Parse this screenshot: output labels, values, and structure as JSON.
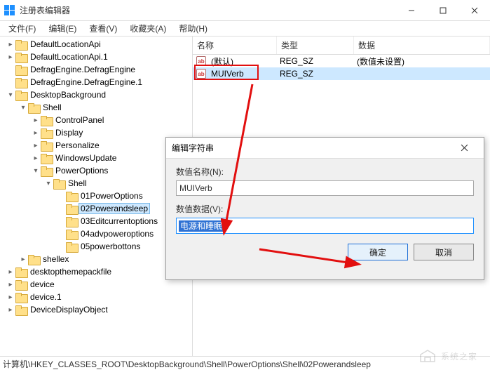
{
  "window": {
    "title": "注册表编辑器",
    "min": "–",
    "max": "□",
    "close": "×"
  },
  "menu": {
    "file": "文件(F)",
    "edit": "编辑(E)",
    "view": "查看(V)",
    "fav": "收藏夹(A)",
    "help": "帮助(H)"
  },
  "list": {
    "headers": {
      "name": "名称",
      "type": "类型",
      "data": "数据"
    },
    "rows": [
      {
        "name": "(默认)",
        "type": "REG_SZ",
        "data": "(数值未设置)",
        "selected": false
      },
      {
        "name": "MUIVerb",
        "type": "REG_SZ",
        "data": "",
        "selected": true
      }
    ],
    "value_icon_text": "ab"
  },
  "tree": [
    {
      "depth": 0,
      "exp": ">",
      "label": "DefaultLocationApi"
    },
    {
      "depth": 0,
      "exp": ">",
      "label": "DefaultLocationApi.1"
    },
    {
      "depth": 0,
      "exp": "",
      "label": "DefragEngine.DefragEngine"
    },
    {
      "depth": 0,
      "exp": "",
      "label": "DefragEngine.DefragEngine.1"
    },
    {
      "depth": 0,
      "exp": "v",
      "label": "DesktopBackground"
    },
    {
      "depth": 1,
      "exp": "v",
      "label": "Shell"
    },
    {
      "depth": 2,
      "exp": ">",
      "label": "ControlPanel"
    },
    {
      "depth": 2,
      "exp": ">",
      "label": "Display"
    },
    {
      "depth": 2,
      "exp": ">",
      "label": "Personalize"
    },
    {
      "depth": 2,
      "exp": ">",
      "label": "WindowsUpdate"
    },
    {
      "depth": 2,
      "exp": "v",
      "label": "PowerOptions"
    },
    {
      "depth": 3,
      "exp": "v",
      "label": "Shell"
    },
    {
      "depth": 4,
      "exp": "",
      "label": "01PowerOptions"
    },
    {
      "depth": 4,
      "exp": "",
      "label": "02Powerandsleep",
      "selected": true
    },
    {
      "depth": 4,
      "exp": "",
      "label": "03Editcurrentoptions"
    },
    {
      "depth": 4,
      "exp": "",
      "label": "04advpoweroptions"
    },
    {
      "depth": 4,
      "exp": "",
      "label": "05powerbottons"
    },
    {
      "depth": 1,
      "exp": ">",
      "label": "shellex"
    },
    {
      "depth": 0,
      "exp": ">",
      "label": "desktopthemepackfile"
    },
    {
      "depth": 0,
      "exp": ">",
      "label": "device"
    },
    {
      "depth": 0,
      "exp": ">",
      "label": "device.1"
    },
    {
      "depth": 0,
      "exp": ">",
      "label": "DeviceDisplayObject"
    }
  ],
  "dialog": {
    "title": "编辑字符串",
    "name_label": "数值名称(N):",
    "name_value": "MUIVerb",
    "data_label": "数值数据(V):",
    "data_value": "电源和睡眠",
    "ok": "确定",
    "cancel": "取消"
  },
  "statusbar": "计算机\\HKEY_CLASSES_ROOT\\DesktopBackground\\Shell\\PowerOptions\\Shell\\02Powerandsleep",
  "watermark": "系统之家"
}
